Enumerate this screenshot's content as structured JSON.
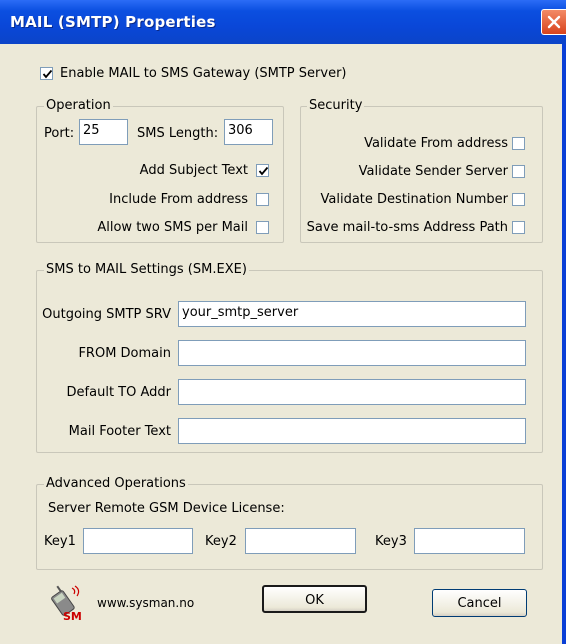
{
  "window": {
    "title": "MAIL (SMTP) Properties"
  },
  "enable_gateway": {
    "label": "Enable MAIL to SMS Gateway (SMTP Server)",
    "checked": true
  },
  "operation": {
    "title": "Operation",
    "port_label": "Port:",
    "port_value": "25",
    "sms_length_label": "SMS Length:",
    "sms_length_value": "306",
    "add_subject_label": "Add Subject Text",
    "add_subject_checked": true,
    "include_from_label": "Include From address",
    "include_from_checked": false,
    "allow_two_label": "Allow two SMS per Mail",
    "allow_two_checked": false
  },
  "security": {
    "title": "Security",
    "validate_from_label": "Validate From address",
    "validate_sender_label": "Validate Sender Server",
    "validate_destination_label": "Validate Destination Number",
    "save_path_label": "Save mail-to-sms Address Path"
  },
  "sms_to_mail": {
    "title": "SMS to MAIL Settings (SM.EXE)",
    "smtp_label": "Outgoing SMTP SRV",
    "smtp_value": "your_smtp_server",
    "from_domain_label": "FROM Domain",
    "from_domain_value": "",
    "default_to_label": "Default TO Addr",
    "default_to_value": "",
    "footer_label": "Mail Footer Text",
    "footer_value": ""
  },
  "advanced": {
    "title": "Advanced Operations",
    "license_label": "Server Remote GSM Device License:",
    "key1_label": "Key1",
    "key2_label": "Key2",
    "key3_label": "Key3",
    "key1_value": "",
    "key2_value": "",
    "key3_value": ""
  },
  "footer": {
    "logo_text": "SM",
    "website": "www.sysman.no",
    "ok_label": "OK",
    "cancel_label": "Cancel"
  },
  "icons": {
    "close": "close-icon",
    "check": "check-icon",
    "logo": "sysman-logo-icon"
  }
}
